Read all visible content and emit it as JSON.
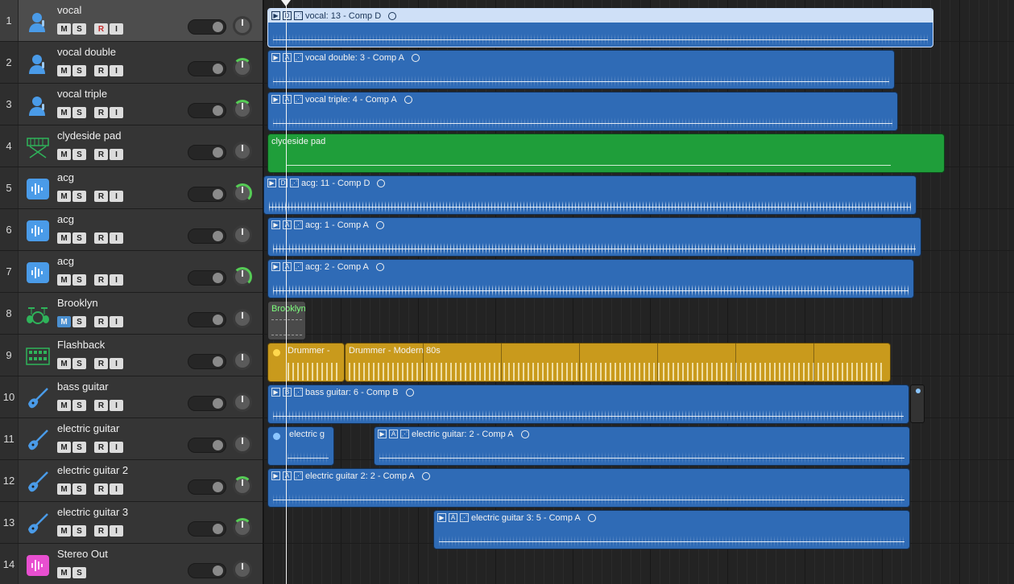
{
  "tracks": [
    {
      "number": "1",
      "name": "vocal",
      "icon": "singer-icon",
      "buttons": [
        "M",
        "S",
        "R",
        "I"
      ],
      "record_armed": true,
      "selected": true
    },
    {
      "number": "2",
      "name": "vocal double",
      "icon": "singer-icon",
      "buttons": [
        "M",
        "S",
        "R",
        "I"
      ]
    },
    {
      "number": "3",
      "name": "vocal triple",
      "icon": "singer-icon",
      "buttons": [
        "M",
        "S",
        "R",
        "I"
      ]
    },
    {
      "number": "4",
      "name": "clydeside pad",
      "icon": "synth-keyboard-icon",
      "buttons": [
        "M",
        "S",
        "R",
        "I"
      ]
    },
    {
      "number": "5",
      "name": "acg",
      "icon": "audio-waveform-icon",
      "buttons": [
        "M",
        "S",
        "R",
        "I"
      ]
    },
    {
      "number": "6",
      "name": "acg",
      "icon": "audio-waveform-icon",
      "buttons": [
        "M",
        "S",
        "R",
        "I"
      ]
    },
    {
      "number": "7",
      "name": "acg",
      "icon": "audio-waveform-icon",
      "buttons": [
        "M",
        "S",
        "R",
        "I"
      ]
    },
    {
      "number": "8",
      "name": "Brooklyn",
      "icon": "drum-kit-icon",
      "buttons": [
        "M",
        "S",
        "R",
        "I"
      ],
      "muted": true
    },
    {
      "number": "9",
      "name": "Flashback",
      "icon": "drum-machine-icon",
      "buttons": [
        "M",
        "S",
        "R",
        "I"
      ]
    },
    {
      "number": "10",
      "name": "bass guitar",
      "icon": "bass-guitar-icon",
      "buttons": [
        "M",
        "S",
        "R",
        "I"
      ]
    },
    {
      "number": "11",
      "name": "electric guitar",
      "icon": "electric-guitar-icon",
      "buttons": [
        "M",
        "S",
        "R",
        "I"
      ]
    },
    {
      "number": "12",
      "name": "electric guitar 2",
      "icon": "electric-guitar-icon",
      "buttons": [
        "M",
        "S",
        "R",
        "I"
      ]
    },
    {
      "number": "13",
      "name": "electric guitar 3",
      "icon": "electric-guitar-icon",
      "buttons": [
        "M",
        "S",
        "R",
        "I"
      ]
    },
    {
      "number": "14",
      "name": "Stereo Out",
      "icon": "output-waveform-icon",
      "buttons": [
        "M",
        "S"
      ]
    }
  ],
  "regions": {
    "r1": {
      "take": "D",
      "label": "vocal: 13 - Comp D"
    },
    "r2": {
      "take": "A",
      "label": "vocal double: 3 - Comp A"
    },
    "r3": {
      "take": "A",
      "label": "vocal triple: 4 - Comp A"
    },
    "r4": {
      "label": "clydeside pad"
    },
    "r5": {
      "take": "D",
      "label": "acg: 11 - Comp D"
    },
    "r6": {
      "take": "A",
      "label": "acg: 1 - Comp A"
    },
    "r7": {
      "take": "A",
      "label": "acg: 2 - Comp A"
    },
    "r8": {
      "label": "Brooklyn"
    },
    "r9a": {
      "label": "Drummer -"
    },
    "r9b": {
      "label": "Drummer - Modern 80s"
    },
    "r10": {
      "take": "B",
      "label": "bass guitar: 6 - Comp B"
    },
    "r11a": {
      "label": "electric g"
    },
    "r11b": {
      "take": "A",
      "label": "electric guitar: 2 - Comp A"
    },
    "r12": {
      "take": "A",
      "label": "electric guitar 2: 2 - Comp A"
    },
    "r13": {
      "take": "A",
      "label": "electric guitar 3: 5 - Comp A"
    }
  },
  "colors": {
    "audio_region": "#2f6bb6",
    "pad_region": "#1f9e3a",
    "drummer_region": "#c99a1c",
    "track_icon_blue": "#4a9be8",
    "stereo_out_icon": "#e84fd0"
  }
}
